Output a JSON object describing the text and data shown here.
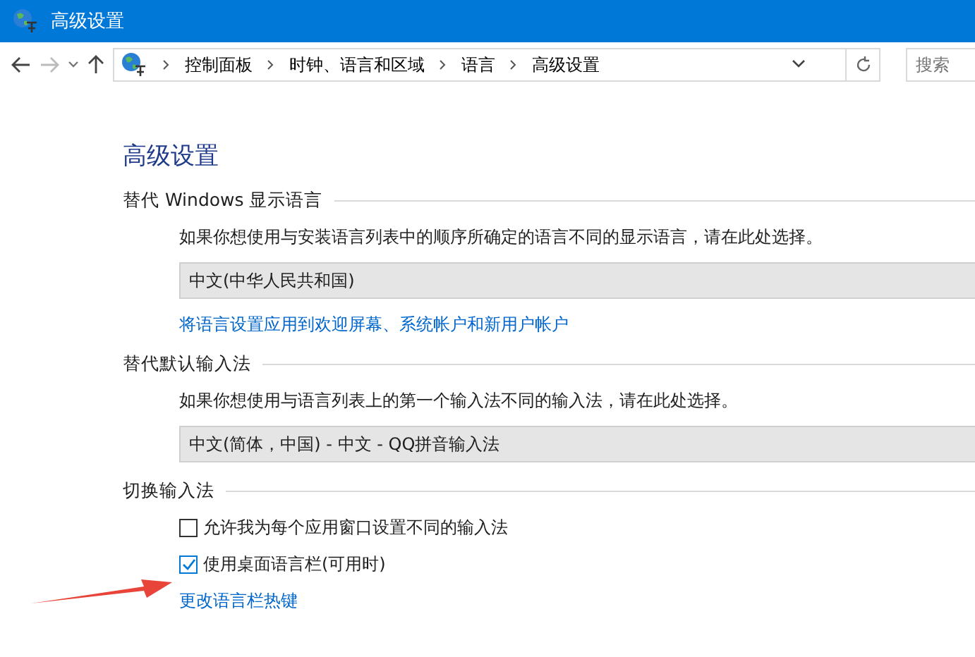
{
  "window": {
    "title": "高级设置"
  },
  "address_bar": {
    "breadcrumbs": [
      "控制面板",
      "时钟、语言和区域",
      "语言",
      "高级设置"
    ],
    "search": {
      "placeholder": "搜索"
    }
  },
  "heading": "高级设置",
  "sections": [
    {
      "title": "替代 Windows 显示语言",
      "description": "如果你想使用与安装语言列表中的顺序所确定的语言不同的显示语言，请在此处选择。",
      "dropdown": "中文(中华人民共和国)",
      "link": "将语言设置应用到欢迎屏幕、系统帐户和新用户帐户"
    },
    {
      "title": "替代默认输入法",
      "description": "如果你想使用与语言列表上的第一个输入法不同的输入法，请在此处选择。",
      "dropdown": "中文(简体，中国) - 中文 - QQ拼音输入法"
    },
    {
      "title": "切换输入法",
      "checkboxes": [
        {
          "label": "允许我为每个应用窗口设置不同的输入法",
          "checked": false
        },
        {
          "label": "使用桌面语言栏(可用时)",
          "checked": true
        }
      ],
      "link": "更改语言栏热键"
    }
  ]
}
